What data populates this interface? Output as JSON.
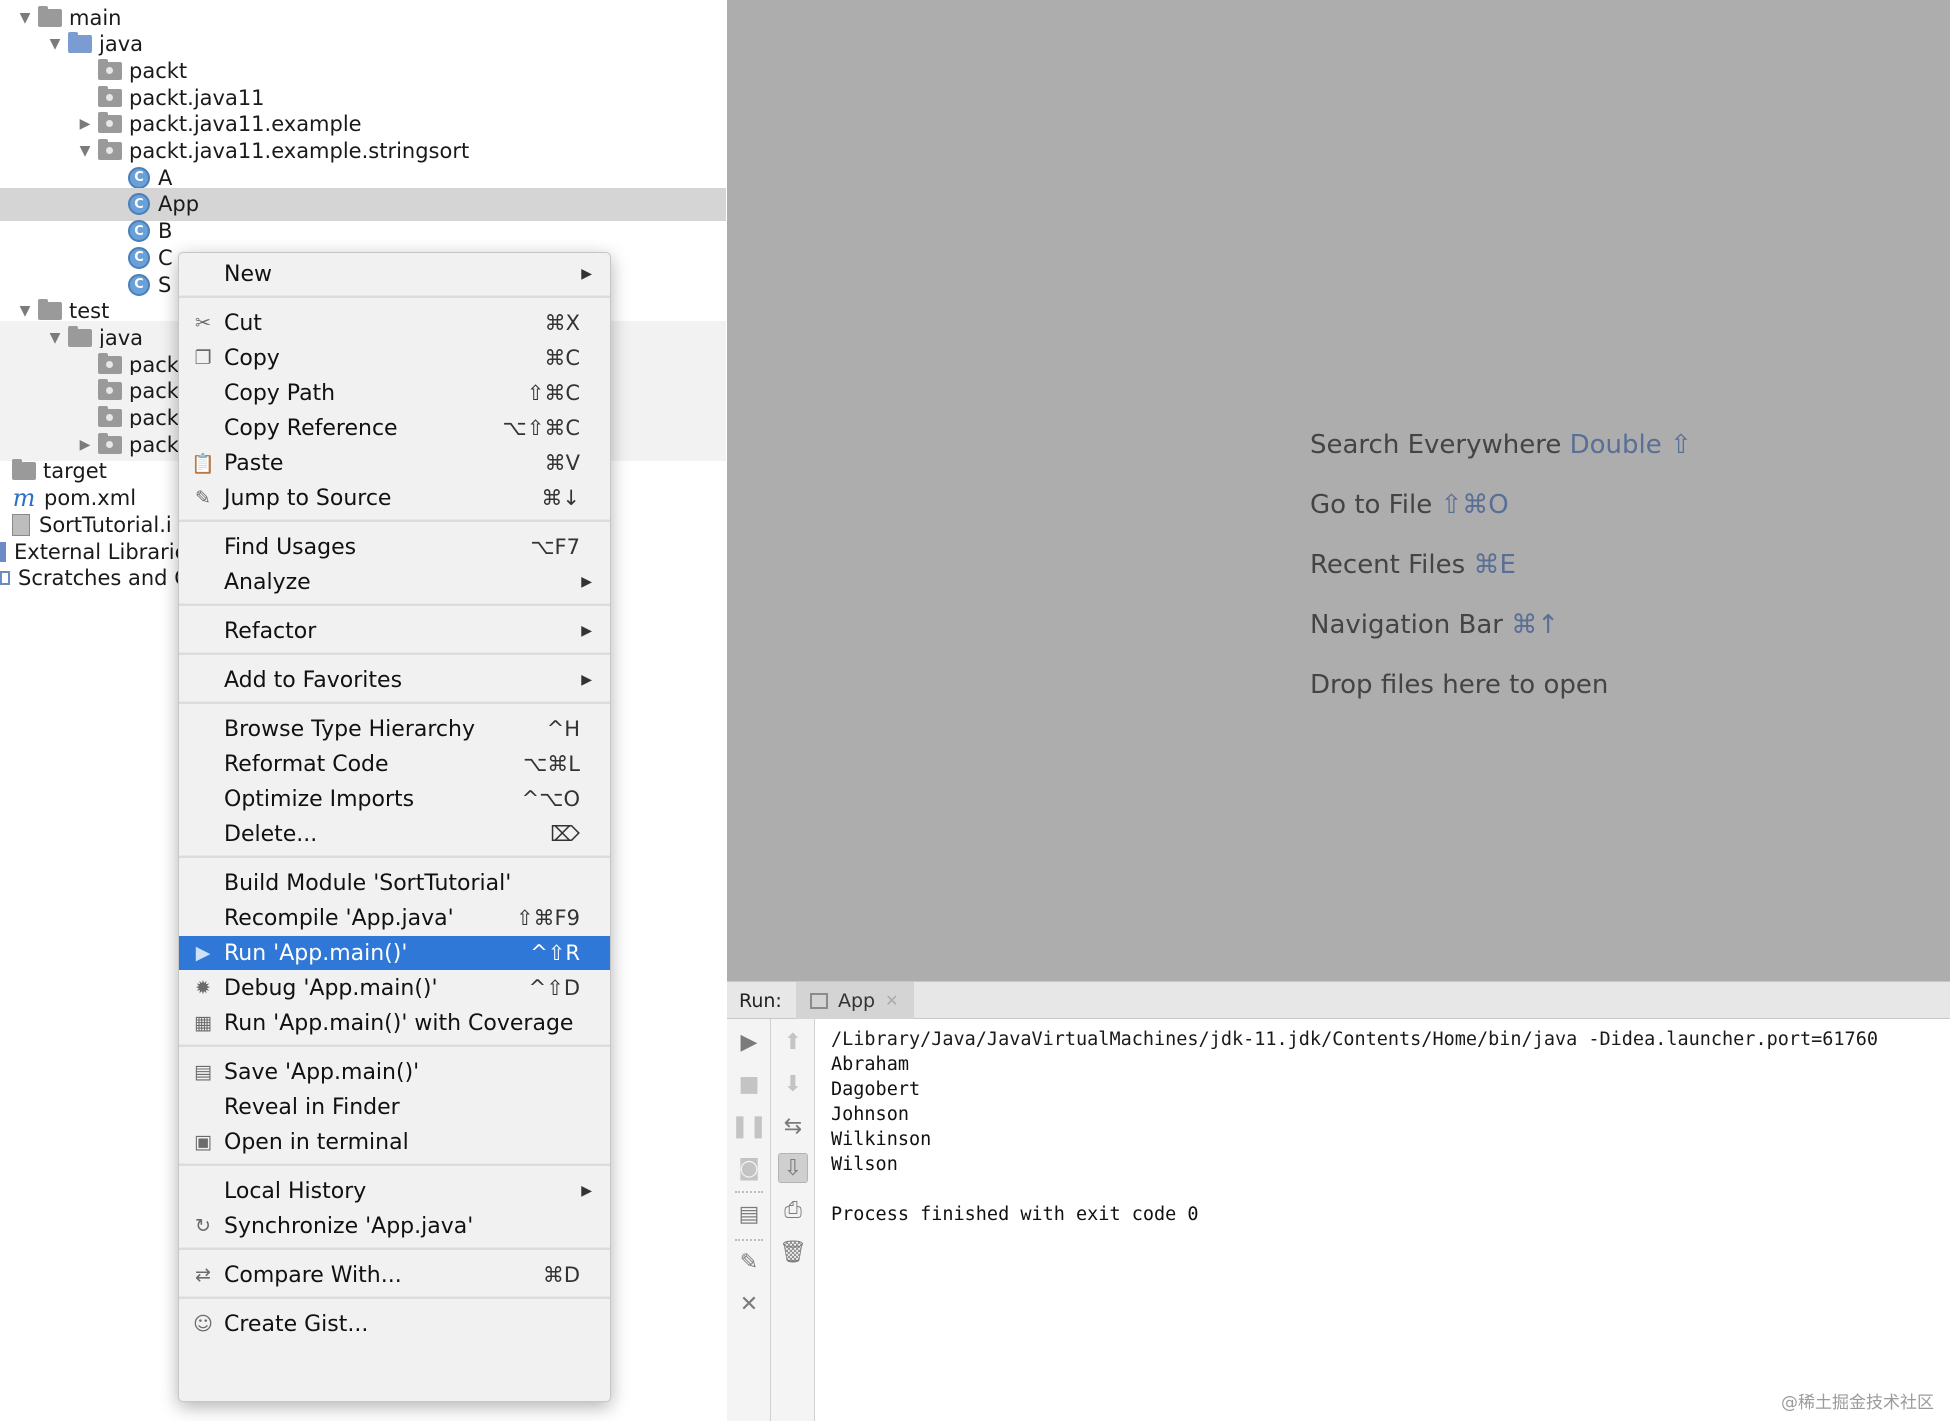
{
  "project_tree": [
    {
      "label": "main",
      "arrow": "▼",
      "indent": 0,
      "icon": "folder"
    },
    {
      "label": "java",
      "arrow": "▼",
      "indent": 1,
      "icon": "folder-blue"
    },
    {
      "label": "packt",
      "arrow": "",
      "indent": 2,
      "icon": "package"
    },
    {
      "label": "packt.java11",
      "arrow": "",
      "indent": 2,
      "icon": "package"
    },
    {
      "label": "packt.java11.example",
      "arrow": "▶",
      "indent": 2,
      "icon": "package"
    },
    {
      "label": "packt.java11.example.stringsort",
      "arrow": "▼",
      "indent": 2,
      "icon": "package"
    },
    {
      "label": "A",
      "arrow": "",
      "indent": 3,
      "icon": "class"
    },
    {
      "label": "App",
      "arrow": "",
      "indent": 3,
      "icon": "class-run"
    },
    {
      "label": "B",
      "arrow": "",
      "indent": 3,
      "icon": "class-run"
    },
    {
      "label": "C",
      "arrow": "",
      "indent": 3,
      "icon": "class-run"
    },
    {
      "label": "S",
      "arrow": "",
      "indent": 3,
      "icon": "class"
    },
    {
      "label": "test",
      "arrow": "▼",
      "indent": 0,
      "icon": "folder"
    },
    {
      "label": "java",
      "arrow": "▼",
      "indent": 1,
      "icon": "folder"
    },
    {
      "label": "pack",
      "arrow": "",
      "indent": 2,
      "icon": "package"
    },
    {
      "label": "pack",
      "arrow": "",
      "indent": 2,
      "icon": "package"
    },
    {
      "label": "pack",
      "arrow": "",
      "indent": 2,
      "icon": "package"
    },
    {
      "label": "pack",
      "arrow": "▶",
      "indent": 2,
      "icon": "package"
    },
    {
      "label": "target",
      "arrow": "",
      "indent": -1,
      "icon": "folder"
    },
    {
      "label": "pom.xml",
      "arrow": "",
      "indent": -1,
      "icon": "maven"
    },
    {
      "label": "SortTutorial.i",
      "arrow": "",
      "indent": -1,
      "icon": "file"
    },
    {
      "label": "External Librarie",
      "arrow": "",
      "indent": -2,
      "icon": "library"
    },
    {
      "label": "Scratches and C",
      "arrow": "",
      "indent": -2,
      "icon": "scratch"
    }
  ],
  "context_menu": {
    "items": [
      {
        "label": "New",
        "shortcut": "",
        "submenu": true,
        "icon": ""
      },
      {
        "label": "Cut",
        "shortcut": "⌘X",
        "submenu": false,
        "icon": "✂"
      },
      {
        "label": "Copy",
        "shortcut": "⌘C",
        "submenu": false,
        "icon": "❐"
      },
      {
        "label": "Copy Path",
        "shortcut": "⇧⌘C",
        "submenu": false,
        "icon": ""
      },
      {
        "label": "Copy Reference",
        "shortcut": "⌥⇧⌘C",
        "submenu": false,
        "icon": ""
      },
      {
        "label": "Paste",
        "shortcut": "⌘V",
        "submenu": false,
        "icon": "📋"
      },
      {
        "label": "Jump to Source",
        "shortcut": "⌘↓",
        "submenu": false,
        "icon": "✎"
      },
      {
        "label": "Find Usages",
        "shortcut": "⌥F7",
        "submenu": false,
        "icon": ""
      },
      {
        "label": "Analyze",
        "shortcut": "",
        "submenu": true,
        "icon": ""
      },
      {
        "label": "Refactor",
        "shortcut": "",
        "submenu": true,
        "icon": ""
      },
      {
        "label": "Add to Favorites",
        "shortcut": "",
        "submenu": true,
        "icon": ""
      },
      {
        "label": "Browse Type Hierarchy",
        "shortcut": "^H",
        "submenu": false,
        "icon": ""
      },
      {
        "label": "Reformat Code",
        "shortcut": "⌥⌘L",
        "submenu": false,
        "icon": ""
      },
      {
        "label": "Optimize Imports",
        "shortcut": "^⌥O",
        "submenu": false,
        "icon": ""
      },
      {
        "label": "Delete...",
        "shortcut": "⌦",
        "submenu": false,
        "icon": ""
      },
      {
        "label": "Build Module 'SortTutorial'",
        "shortcut": "",
        "submenu": false,
        "icon": ""
      },
      {
        "label": "Recompile 'App.java'",
        "shortcut": "⇧⌘F9",
        "submenu": false,
        "icon": ""
      },
      {
        "label": "Run 'App.main()'",
        "shortcut": "^⇧R",
        "submenu": false,
        "icon": "▶",
        "selected": true
      },
      {
        "label": "Debug 'App.main()'",
        "shortcut": "^⇧D",
        "submenu": false,
        "icon": "✹"
      },
      {
        "label": "Run 'App.main()' with Coverage",
        "shortcut": "",
        "submenu": false,
        "icon": "▦"
      },
      {
        "label": "Save 'App.main()'",
        "shortcut": "",
        "submenu": false,
        "icon": "▤"
      },
      {
        "label": "Reveal in Finder",
        "shortcut": "",
        "submenu": false,
        "icon": ""
      },
      {
        "label": "Open in terminal",
        "shortcut": "",
        "submenu": false,
        "icon": "▣"
      },
      {
        "label": "Local History",
        "shortcut": "",
        "submenu": true,
        "icon": ""
      },
      {
        "label": "Synchronize 'App.java'",
        "shortcut": "",
        "submenu": false,
        "icon": "↻"
      },
      {
        "label": "Compare With...",
        "shortcut": "⌘D",
        "submenu": false,
        "icon": "⇄"
      },
      {
        "label": "Create Gist...",
        "shortcut": "",
        "submenu": false,
        "icon": "☺"
      }
    ]
  },
  "editor_hints": {
    "search_everywhere": {
      "text": "Search Everywhere",
      "key": "Double ⇧"
    },
    "go_to_file": {
      "text": "Go to File",
      "key": "⇧⌘O"
    },
    "recent_files": {
      "text": "Recent Files",
      "key": "⌘E"
    },
    "navigation_bar": {
      "text": "Navigation Bar",
      "key": "⌘↑"
    },
    "drop_files": {
      "text": "Drop files here to open"
    }
  },
  "run_panel": {
    "label": "Run:",
    "tab_label": "App",
    "console_lines": [
      "/Library/Java/JavaVirtualMachines/jdk-11.jdk/Contents/Home/bin/java -Didea.launcher.port=61760",
      "Abraham",
      "Dagobert",
      "Johnson",
      "Wilkinson",
      "Wilson",
      "",
      "Process finished with exit code 0"
    ]
  },
  "watermark": "@稀土掘金技术社区",
  "colors": {
    "menu_selection": "#2f78d8",
    "editor_background": "#adadad",
    "tree_selection": "#d5d5d5"
  }
}
